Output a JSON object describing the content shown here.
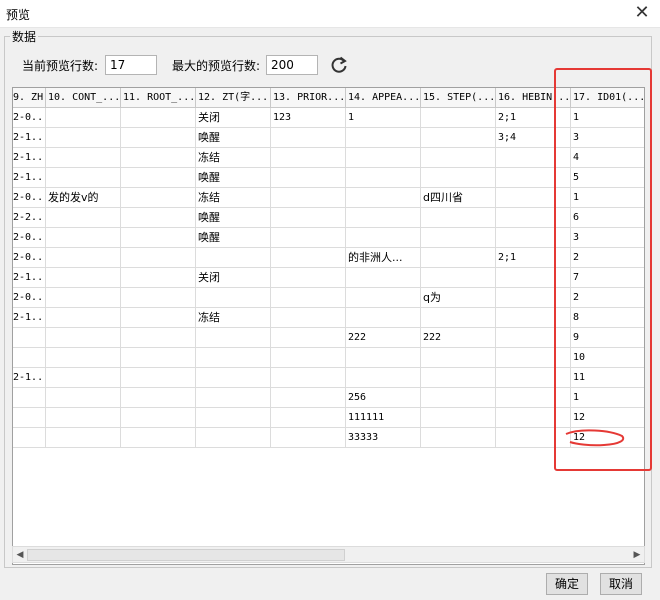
{
  "window": {
    "title": "预览"
  },
  "group": {
    "label": "数据"
  },
  "controls": {
    "current_rows_label": "当前预览行数:",
    "current_rows_value": "17",
    "max_rows_label": "最大的预览行数:",
    "max_rows_value": "200"
  },
  "table": {
    "columns": [
      "9. ZH(...",
      "10. CONT_...",
      "11. ROOT_...",
      "12. ZT(字...",
      "13. PRIOR...",
      "14. APPEA...",
      "15. STEP(...",
      "16. HEBIN...",
      "17. ID01(..."
    ],
    "rows": [
      [
        "2-0...",
        "",
        "",
        "关闭",
        "123",
        "1",
        "",
        "2;1",
        "1"
      ],
      [
        "2-1...",
        "",
        "",
        "唤醒",
        "",
        "",
        "",
        "3;4",
        "3"
      ],
      [
        "2-1...",
        "",
        "",
        "冻结",
        "",
        "",
        "",
        "",
        "4"
      ],
      [
        "2-1...",
        "",
        "",
        "唤醒",
        "",
        "",
        "",
        "",
        "5"
      ],
      [
        "2-0...",
        "发的发v的",
        "",
        "冻结",
        "",
        "",
        "d四川省",
        "",
        "1"
      ],
      [
        "2-2...",
        "",
        "",
        "唤醒",
        "",
        "",
        "",
        "",
        "6"
      ],
      [
        "2-0...",
        "",
        "",
        "唤醒",
        "",
        "",
        "",
        "",
        "3"
      ],
      [
        "2-0...",
        "",
        "",
        "",
        "",
        "的非洲人...",
        "",
        "2;1",
        "2"
      ],
      [
        "2-1...",
        "",
        "",
        "关闭",
        "",
        "",
        "",
        "",
        "7"
      ],
      [
        "2-0...",
        "",
        "",
        "",
        "",
        "",
        "q为",
        "",
        "2"
      ],
      [
        "2-1...",
        "",
        "",
        "冻结",
        "",
        "",
        "",
        "",
        "8"
      ],
      [
        "",
        "",
        "",
        "",
        "",
        "222",
        "222",
        "",
        "9"
      ],
      [
        "",
        "",
        "",
        "",
        "",
        "",
        "",
        "",
        "10"
      ],
      [
        "2-1...",
        "",
        "",
        "",
        "",
        "",
        "",
        "",
        "11"
      ],
      [
        "",
        "",
        "",
        "",
        "",
        "256",
        "",
        "",
        "1"
      ],
      [
        "",
        "",
        "",
        "",
        "",
        "111111",
        "",
        "",
        "12"
      ],
      [
        "",
        "",
        "",
        "",
        "",
        "33333",
        "",
        "",
        "12"
      ]
    ]
  },
  "buttons": {
    "ok": "确定",
    "cancel": "取消"
  },
  "colors": {
    "highlight": "#e53935"
  }
}
